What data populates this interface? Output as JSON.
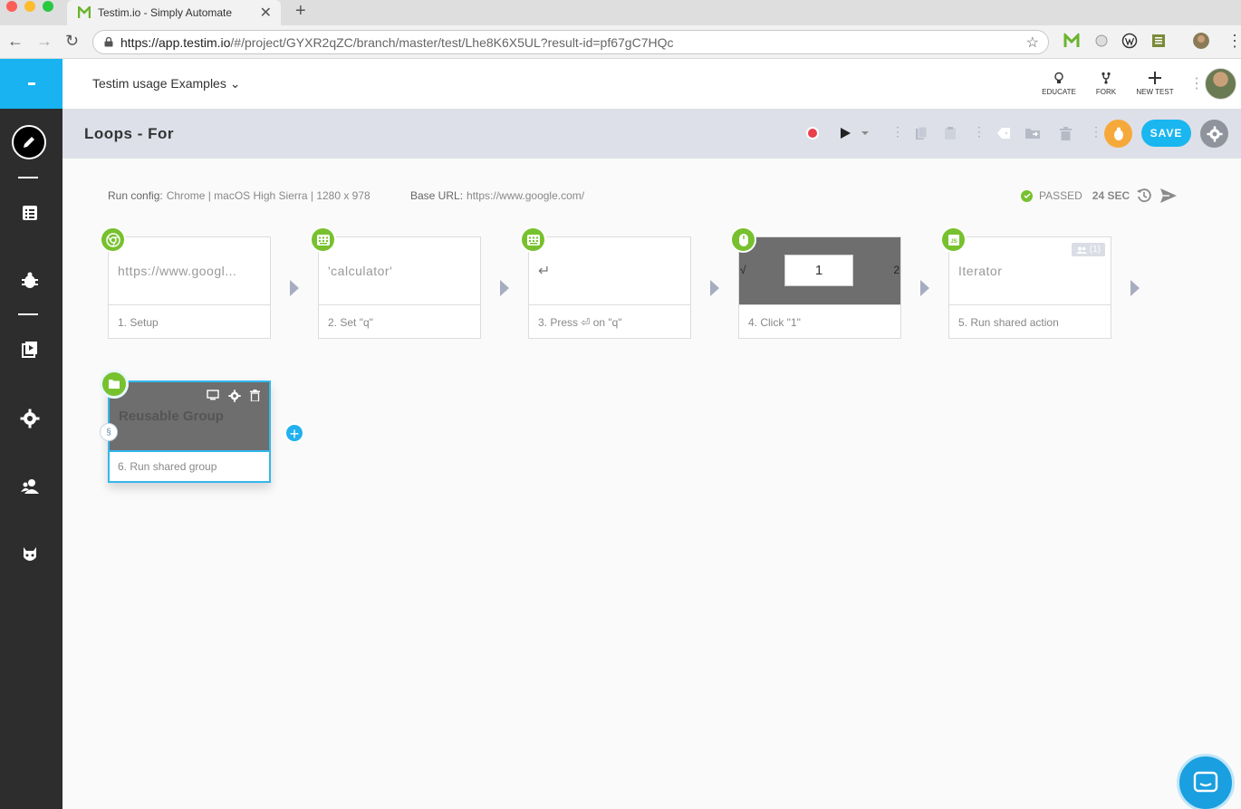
{
  "browser": {
    "tab_title": "Testim.io - Simply Automate",
    "close_glyph": "✕",
    "newtab_glyph": "+",
    "url_host": "https://app.testim.io",
    "url_path": "/#/project/GYXR2qZC/branch/master/test/Lhe8K6X5UL?result-id=pf67gC7HQc",
    "star_glyph": "☆",
    "back_glyph": "←",
    "forward_glyph": "→",
    "reload_glyph": "↻",
    "menu_glyph": "⋮"
  },
  "header": {
    "project_name": "Testim usage Examples",
    "chevron": "⌄",
    "actions": [
      {
        "label": "EDUCATE",
        "icon": "lightbulb-icon"
      },
      {
        "label": "FORK",
        "icon": "fork-icon"
      },
      {
        "label": "NEW TEST",
        "icon": "plus-icon"
      }
    ]
  },
  "toolbar": {
    "test_name": "Loops - For",
    "save_label": "SAVE",
    "dots": "⋮"
  },
  "run_info": {
    "config_label": "Run config:",
    "config_value": "Chrome | macOS High Sierra | 1280 x 978",
    "base_label": "Base URL:",
    "base_value": "https://www.google.com/",
    "status": "PASSED",
    "duration": "24 SEC"
  },
  "steps": [
    {
      "index": 1,
      "content": "https://www.googl...",
      "caption": "1. Setup",
      "icon": "chrome-icon"
    },
    {
      "index": 2,
      "content": "'calculator'",
      "caption": "2. Set \"q\"",
      "icon": "keyboard-icon"
    },
    {
      "index": 3,
      "content": "↵",
      "caption": "3. Press ⏎ on \"q\"",
      "icon": "keyboard-icon"
    },
    {
      "index": 4,
      "content": "1",
      "thumb_left": "√",
      "thumb_right": "2",
      "caption": "4. Click \"1\"",
      "icon": "mouse-icon"
    },
    {
      "index": 5,
      "content": "Iterator",
      "caption": "5. Run shared action",
      "icon": "js-icon",
      "shared_count": "(1)"
    }
  ],
  "group": {
    "content": "Reusable Group",
    "caption": "6. Run shared group",
    "icon": "folder-icon",
    "loop_glyph": "§"
  },
  "add_glyph": "+",
  "colors": {
    "accent": "#1ab6f0",
    "success": "#77c12e",
    "nav_bg": "#2d2d2d",
    "subheader_bg": "#dde0e8",
    "warning": "#f6a93b"
  }
}
